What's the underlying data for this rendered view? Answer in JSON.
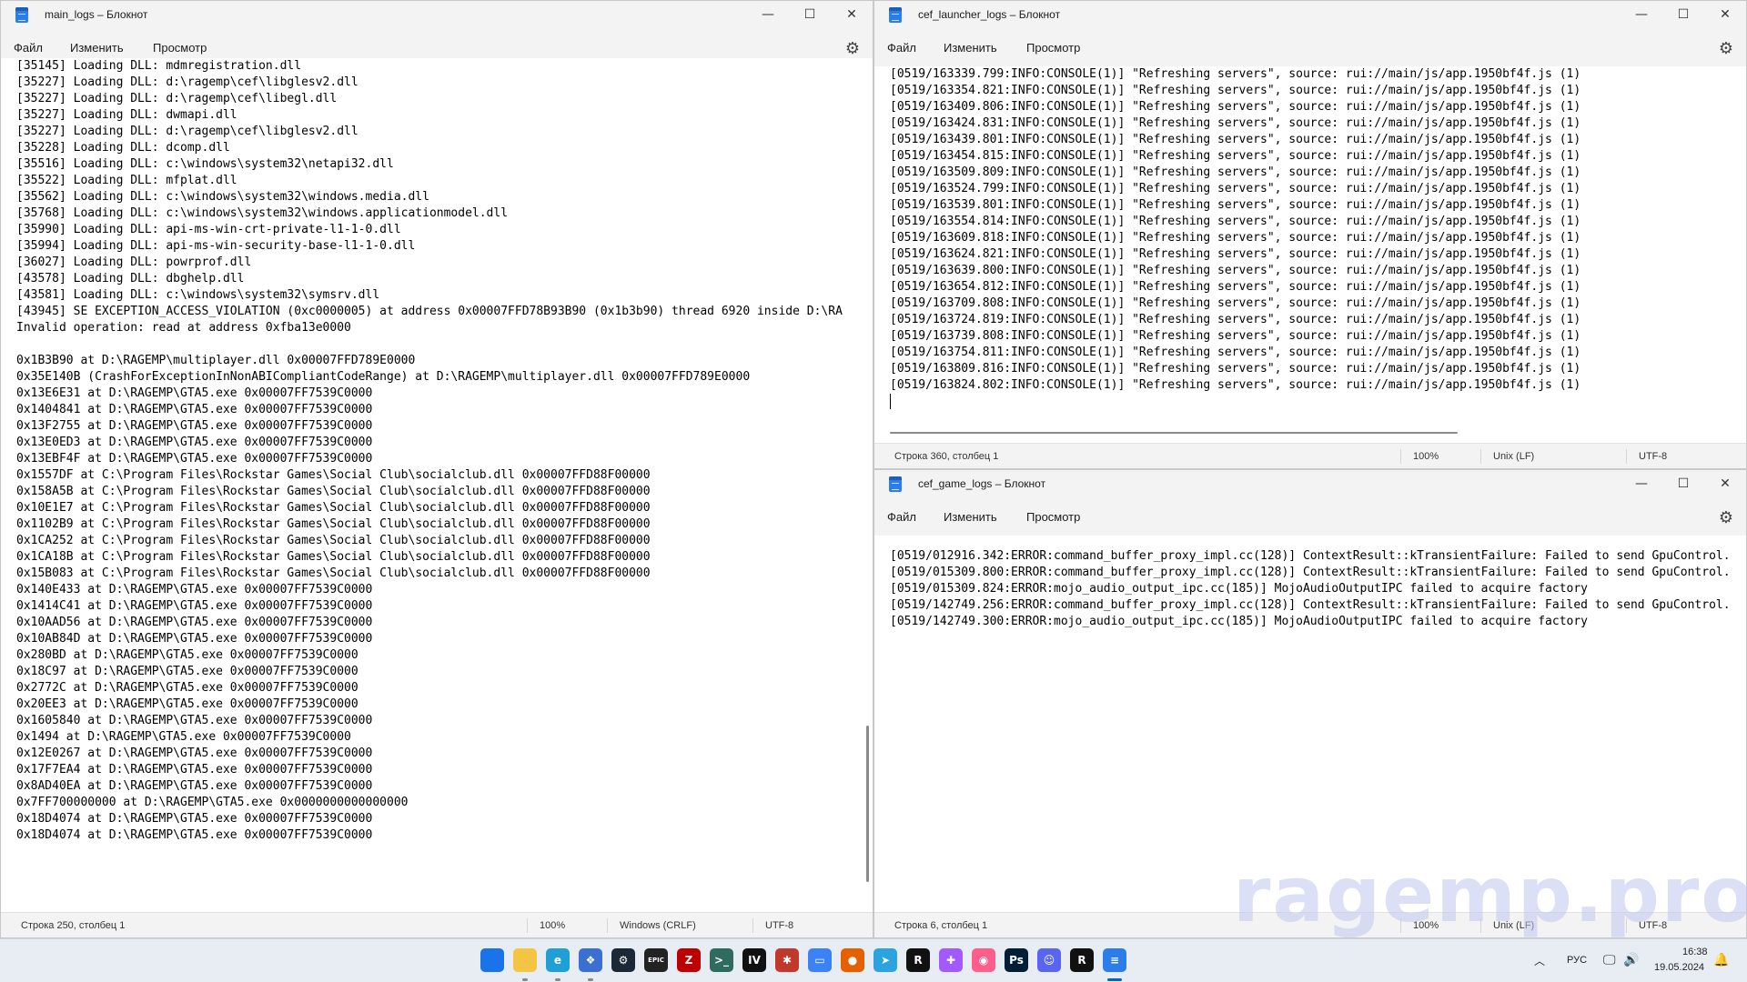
{
  "windows": {
    "main": {
      "title": "main_logs – Блокнот",
      "menu": [
        "Файл",
        "Изменить",
        "Просмотр"
      ],
      "lines": [
        "[35145] Loading DLL: mdmregistration.dll",
        "[35227] Loading DLL: d:\\ragemp\\cef\\libglesv2.dll",
        "[35227] Loading DLL: d:\\ragemp\\cef\\libegl.dll",
        "[35227] Loading DLL: dwmapi.dll",
        "[35227] Loading DLL: d:\\ragemp\\cef\\libglesv2.dll",
        "[35228] Loading DLL: dcomp.dll",
        "[35516] Loading DLL: c:\\windows\\system32\\netapi32.dll",
        "[35522] Loading DLL: mfplat.dll",
        "[35562] Loading DLL: c:\\windows\\system32\\windows.media.dll",
        "[35768] Loading DLL: c:\\windows\\system32\\windows.applicationmodel.dll",
        "[35990] Loading DLL: api-ms-win-crt-private-l1-1-0.dll",
        "[35994] Loading DLL: api-ms-win-security-base-l1-1-0.dll",
        "[36027] Loading DLL: powrprof.dll",
        "[43578] Loading DLL: dbghelp.dll",
        "[43581] Loading DLL: c:\\windows\\system32\\symsrv.dll",
        "[43945] SE EXCEPTION_ACCESS_VIOLATION (0xc0000005) at address 0x00007FFD78B93B90 (0x1b3b90) thread 6920 inside D:\\RA",
        "Invalid operation: read at address 0xfba13e0000",
        "",
        "0x1B3B90 at D:\\RAGEMP\\multiplayer.dll 0x00007FFD789E0000",
        "0x35E140B (CrashForExceptionInNonABICompliantCodeRange) at D:\\RAGEMP\\multiplayer.dll 0x00007FFD789E0000",
        "0x13E6E31 at D:\\RAGEMP\\GTA5.exe 0x00007FF7539C0000",
        "0x1404841 at D:\\RAGEMP\\GTA5.exe 0x00007FF7539C0000",
        "0x13F2755 at D:\\RAGEMP\\GTA5.exe 0x00007FF7539C0000",
        "0x13E0ED3 at D:\\RAGEMP\\GTA5.exe 0x00007FF7539C0000",
        "0x13EBF4F at D:\\RAGEMP\\GTA5.exe 0x00007FF7539C0000",
        "0x1557DF at C:\\Program Files\\Rockstar Games\\Social Club\\socialclub.dll 0x00007FFD88F00000",
        "0x158A5B at C:\\Program Files\\Rockstar Games\\Social Club\\socialclub.dll 0x00007FFD88F00000",
        "0x10E1E7 at C:\\Program Files\\Rockstar Games\\Social Club\\socialclub.dll 0x00007FFD88F00000",
        "0x1102B9 at C:\\Program Files\\Rockstar Games\\Social Club\\socialclub.dll 0x00007FFD88F00000",
        "0x1CA252 at C:\\Program Files\\Rockstar Games\\Social Club\\socialclub.dll 0x00007FFD88F00000",
        "0x1CA18B at C:\\Program Files\\Rockstar Games\\Social Club\\socialclub.dll 0x00007FFD88F00000",
        "0x15B083 at C:\\Program Files\\Rockstar Games\\Social Club\\socialclub.dll 0x00007FFD88F00000",
        "0x140E433 at D:\\RAGEMP\\GTA5.exe 0x00007FF7539C0000",
        "0x1414C41 at D:\\RAGEMP\\GTA5.exe 0x00007FF7539C0000",
        "0x10AAD56 at D:\\RAGEMP\\GTA5.exe 0x00007FF7539C0000",
        "0x10AB84D at D:\\RAGEMP\\GTA5.exe 0x00007FF7539C0000",
        "0x280BD at D:\\RAGEMP\\GTA5.exe 0x00007FF7539C0000",
        "0x18C97 at D:\\RAGEMP\\GTA5.exe 0x00007FF7539C0000",
        "0x2772C at D:\\RAGEMP\\GTA5.exe 0x00007FF7539C0000",
        "0x20EE3 at D:\\RAGEMP\\GTA5.exe 0x00007FF7539C0000",
        "0x1605840 at D:\\RAGEMP\\GTA5.exe 0x00007FF7539C0000",
        "0x1494 at D:\\RAGEMP\\GTA5.exe 0x00007FF7539C0000",
        "0x12E0267 at D:\\RAGEMP\\GTA5.exe 0x00007FF7539C0000",
        "0x17F7EA4 at D:\\RAGEMP\\GTA5.exe 0x00007FF7539C0000",
        "0x8AD40EA at D:\\RAGEMP\\GTA5.exe 0x00007FF7539C0000",
        "0x7FF700000000 at D:\\RAGEMP\\GTA5.exe 0x0000000000000000",
        "0x18D4074 at D:\\RAGEMP\\GTA5.exe 0x00007FF7539C0000",
        "0x18D4074 at D:\\RAGEMP\\GTA5.exe 0x00007FF7539C0000"
      ],
      "status": {
        "position": "Строка 250, столбец 1",
        "zoom": "100%",
        "eol": "Windows (CRLF)",
        "encoding": "UTF-8"
      }
    },
    "launcher": {
      "title": "cef_launcher_logs – Блокнот",
      "menu": [
        "Файл",
        "Изменить",
        "Просмотр"
      ],
      "lines": [
        "[0519/163339.799:INFO:CONSOLE(1)] \"Refreshing servers\", source: rui://main/js/app.1950bf4f.js (1)",
        "[0519/163354.821:INFO:CONSOLE(1)] \"Refreshing servers\", source: rui://main/js/app.1950bf4f.js (1)",
        "[0519/163409.806:INFO:CONSOLE(1)] \"Refreshing servers\", source: rui://main/js/app.1950bf4f.js (1)",
        "[0519/163424.831:INFO:CONSOLE(1)] \"Refreshing servers\", source: rui://main/js/app.1950bf4f.js (1)",
        "[0519/163439.801:INFO:CONSOLE(1)] \"Refreshing servers\", source: rui://main/js/app.1950bf4f.js (1)",
        "[0519/163454.815:INFO:CONSOLE(1)] \"Refreshing servers\", source: rui://main/js/app.1950bf4f.js (1)",
        "[0519/163509.809:INFO:CONSOLE(1)] \"Refreshing servers\", source: rui://main/js/app.1950bf4f.js (1)",
        "[0519/163524.799:INFO:CONSOLE(1)] \"Refreshing servers\", source: rui://main/js/app.1950bf4f.js (1)",
        "[0519/163539.801:INFO:CONSOLE(1)] \"Refreshing servers\", source: rui://main/js/app.1950bf4f.js (1)",
        "[0519/163554.814:INFO:CONSOLE(1)] \"Refreshing servers\", source: rui://main/js/app.1950bf4f.js (1)",
        "[0519/163609.818:INFO:CONSOLE(1)] \"Refreshing servers\", source: rui://main/js/app.1950bf4f.js (1)",
        "[0519/163624.821:INFO:CONSOLE(1)] \"Refreshing servers\", source: rui://main/js/app.1950bf4f.js (1)",
        "[0519/163639.800:INFO:CONSOLE(1)] \"Refreshing servers\", source: rui://main/js/app.1950bf4f.js (1)",
        "[0519/163654.812:INFO:CONSOLE(1)] \"Refreshing servers\", source: rui://main/js/app.1950bf4f.js (1)",
        "[0519/163709.808:INFO:CONSOLE(1)] \"Refreshing servers\", source: rui://main/js/app.1950bf4f.js (1)",
        "[0519/163724.819:INFO:CONSOLE(1)] \"Refreshing servers\", source: rui://main/js/app.1950bf4f.js (1)",
        "[0519/163739.808:INFO:CONSOLE(1)] \"Refreshing servers\", source: rui://main/js/app.1950bf4f.js (1)",
        "[0519/163754.811:INFO:CONSOLE(1)] \"Refreshing servers\", source: rui://main/js/app.1950bf4f.js (1)",
        "[0519/163809.816:INFO:CONSOLE(1)] \"Refreshing servers\", source: rui://main/js/app.1950bf4f.js (1)",
        "[0519/163824.802:INFO:CONSOLE(1)] \"Refreshing servers\", source: rui://main/js/app.1950bf4f.js (1)"
      ],
      "status": {
        "position": "Строка 360, столбец 1",
        "zoom": "100%",
        "eol": "Unix (LF)",
        "encoding": "UTF-8"
      }
    },
    "game": {
      "title": "cef_game_logs – Блокнот",
      "menu": [
        "Файл",
        "Изменить",
        "Просмотр"
      ],
      "lines": [
        "[0519/012916.342:ERROR:command_buffer_proxy_impl.cc(128)] ContextResult::kTransientFailure: Failed to send GpuControl.",
        "[0519/015309.800:ERROR:command_buffer_proxy_impl.cc(128)] ContextResult::kTransientFailure: Failed to send GpuControl.",
        "[0519/015309.824:ERROR:mojo_audio_output_ipc.cc(185)] MojoAudioOutputIPC failed to acquire factory",
        "[0519/142749.256:ERROR:command_buffer_proxy_impl.cc(128)] ContextResult::kTransientFailure: Failed to send GpuControl.",
        "[0519/142749.300:ERROR:mojo_audio_output_ipc.cc(185)] MojoAudioOutputIPC failed to acquire factory"
      ],
      "status": {
        "position": "Строка 6, столбец 1",
        "zoom": "100%",
        "eol": "Unix (LF)",
        "encoding": "UTF-8"
      }
    }
  },
  "watermark": "ragemp.pro",
  "taskbar": {
    "apps": [
      {
        "name": "start-icon",
        "label": "",
        "color": "#1a73e8"
      },
      {
        "name": "explorer-icon",
        "label": "",
        "color": "#f4c542"
      },
      {
        "name": "edge-icon",
        "label": "e",
        "color": "#1f9fd6"
      },
      {
        "name": "vscode-icon",
        "label": "❖",
        "color": "#3b6fd1"
      },
      {
        "name": "steam-icon",
        "label": "⚙",
        "color": "#1b2838"
      },
      {
        "name": "epic-icon",
        "label": "EPIC",
        "color": "#222222"
      },
      {
        "name": "filezilla-icon",
        "label": "Z",
        "color": "#bf0000"
      },
      {
        "name": "terminal-icon",
        "label": ">_",
        "color": "#2f6b5e"
      },
      {
        "name": "intellij-icon",
        "label": "IV",
        "color": "#111111"
      },
      {
        "name": "star-app-icon",
        "label": "✱",
        "color": "#c0392b"
      },
      {
        "name": "window-app-icon",
        "label": "▭",
        "color": "#3b82f6"
      },
      {
        "name": "firefox-icon",
        "label": "●",
        "color": "#e66000"
      },
      {
        "name": "telegram-icon",
        "label": "➤",
        "color": "#2aa3e0"
      },
      {
        "name": "rockstar-icon",
        "label": "R",
        "color": "#111111"
      },
      {
        "name": "figma-icon",
        "label": "✚",
        "color": "#a259ff"
      },
      {
        "name": "colorful-app-icon",
        "label": "◉",
        "color": "#ff5e8a"
      },
      {
        "name": "photoshop-icon",
        "label": "Ps",
        "color": "#001e36"
      },
      {
        "name": "discord-icon",
        "label": "☺",
        "color": "#5865f2"
      },
      {
        "name": "rockstar-launcher-icon",
        "label": "R",
        "color": "#111111"
      },
      {
        "name": "notepad-icon",
        "label": "≡",
        "color": "#2b7de9"
      }
    ],
    "tray": {
      "lang": "РУС",
      "time": "16:38",
      "date": "19.05.2024"
    }
  }
}
